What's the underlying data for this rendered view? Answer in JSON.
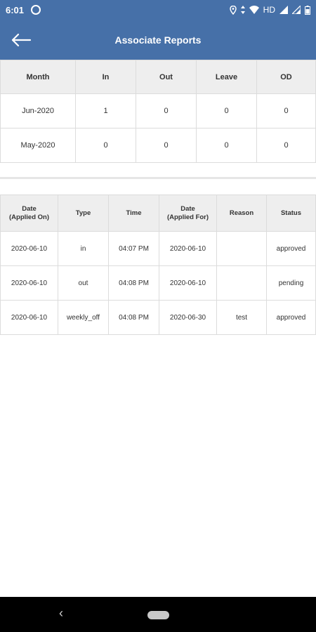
{
  "status_bar": {
    "time": "6:01",
    "right_label": "HD",
    "icons": [
      "sync-icon",
      "location-icon",
      "signal-arrows-icon",
      "wifi-icon",
      "cell-signal-icon",
      "cell-signal-2-icon",
      "battery-icon"
    ]
  },
  "app_bar": {
    "title": "Associate Reports",
    "back_icon": "arrow-left-icon",
    "background": "#4670a8"
  },
  "summary_table": {
    "headers": [
      "Month",
      "In",
      "Out",
      "Leave",
      "OD"
    ],
    "rows": [
      [
        "Jun-2020",
        "1",
        "0",
        "0",
        "0"
      ],
      [
        "May-2020",
        "0",
        "0",
        "0",
        "0"
      ]
    ]
  },
  "detail_table": {
    "headers": [
      [
        "Date",
        "(Applied On)"
      ],
      [
        "Type"
      ],
      [
        "Time"
      ],
      [
        "Date",
        "(Applied For)"
      ],
      [
        "Reason"
      ],
      [
        "Status"
      ]
    ],
    "rows": [
      [
        "2020-06-10",
        "in",
        "04:07 PM",
        "2020-06-10",
        "",
        "approved"
      ],
      [
        "2020-06-10",
        "out",
        "04:08 PM",
        "2020-06-10",
        "",
        "pending"
      ],
      [
        "2020-06-10",
        "weekly_off",
        "04:08 PM",
        "2020-06-30",
        "test",
        "approved"
      ]
    ]
  },
  "nav_bar": {
    "back_glyph": "‹"
  }
}
